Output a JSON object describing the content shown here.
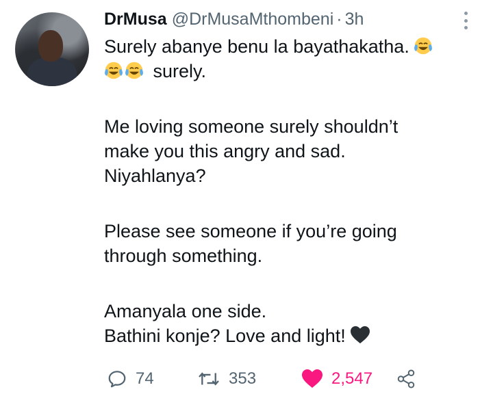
{
  "tweet": {
    "display_name": "DrMusa",
    "handle": "@DrMusaMthombeni",
    "separator": "·",
    "time": "3h",
    "lines": {
      "l1": "Surely abanye benu la bayathakatha.",
      "l2": "surely.",
      "l3": "Me loving someone surely shouldn’t",
      "l4": "make you this angry and sad.",
      "l5": "Niyahlanya?",
      "l6": "Please see someone if you’re going",
      "l7": "through something.",
      "l8": "Amanyala one side.",
      "l9": "Bathini konje? Love and light!"
    },
    "emojis": [
      "face-with-tears-of-joy-emoji",
      "black-heart-emoji"
    ]
  },
  "actions": {
    "replies": "74",
    "retweets": "353",
    "likes": "2,547"
  },
  "colors": {
    "text": "#0f1419",
    "secondary": "#536471",
    "like": "#f91880"
  }
}
